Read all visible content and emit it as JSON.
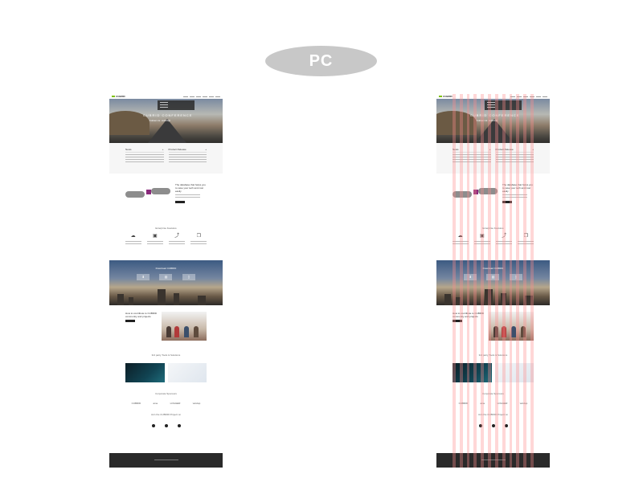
{
  "header": {
    "label": "PC"
  },
  "mockup": {
    "hero_title": "CUBRID CONFERENCE",
    "hero_subtitle": "Follow Us: cubrid@",
    "col1_title": "News",
    "col2_title": "Product Release",
    "hands_heading": "The database that helps you to save your tech and cost easily",
    "features_title": "Enterprise Features",
    "city_title": "Download CUBRID",
    "contrib_heading": "How to contribute to CUBRID community and projects",
    "tools_title": "3rd party Tools & Solutions",
    "sponsors_title": "Corporate Sponsors",
    "sponsors": [
      "CUBRID",
      "ame",
      "LOGGER",
      "windup"
    ],
    "join_title": "Join the CUBRID Project on"
  },
  "colors": {
    "pill": "#c8c8c8",
    "grid_overlay": "#ff8c8c",
    "footer": "#2a2a2a"
  }
}
